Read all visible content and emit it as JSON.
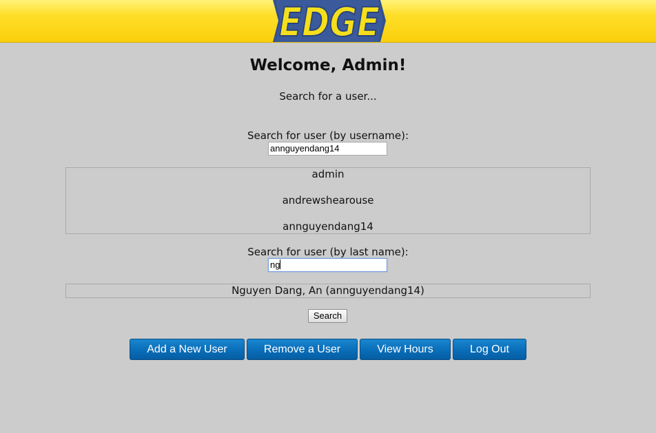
{
  "header": {
    "logo_text": "EDGE",
    "colors": {
      "background": "#f9cf0a",
      "logo_fill": "#f5df1c",
      "logo_outline": "#33518e"
    }
  },
  "main": {
    "welcome": "Welcome, Admin!",
    "subtitle": "Search for a user..."
  },
  "username_search": {
    "label": "Search for user (by username):",
    "value": "annguyendang14",
    "results": [
      "admin",
      "andrewshearouse",
      "annguyendang14"
    ]
  },
  "lastname_search": {
    "label": "Search for user (by last name):",
    "value": "ng",
    "results": [
      "Nguyen Dang, An (annguyendang14)"
    ]
  },
  "search_button": "Search",
  "actions": {
    "add_user": "Add a New User",
    "remove_user": "Remove a User",
    "view_hours": "View Hours",
    "log_out": "Log Out",
    "color": "#0a6db8"
  }
}
